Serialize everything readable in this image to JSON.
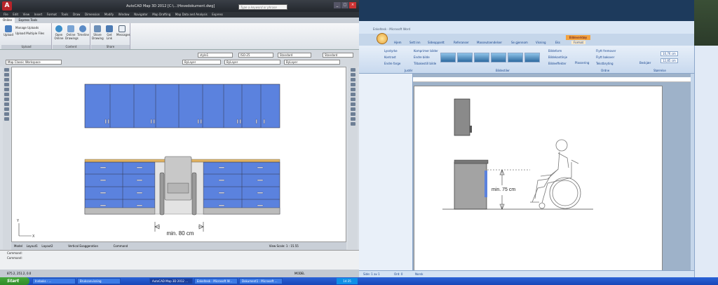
{
  "autocad": {
    "title": "AutoCAD Map 3D 2012  [C:\\...\\Hovedokument.dwg]",
    "search_placeholder": "Type a keyword or phrase",
    "menu": [
      "File",
      "Edit",
      "View",
      "Insert",
      "Format",
      "Tools",
      "Draw",
      "Dimension",
      "Modify",
      "Window",
      "Navigator",
      "Map Drafting",
      "Map Data and Analysis",
      "Express"
    ],
    "tabs": [
      "Online",
      "Express Tools"
    ],
    "ribbon": {
      "upload_group": {
        "label": "Upload",
        "upload": "Upload",
        "manage": "Manage Uploads",
        "multiple": "Upload Multiple Files"
      },
      "content_group": {
        "label": "Content",
        "open_online": "Open Online",
        "online_drawings": "Online Drawings",
        "timeline": "Timeline"
      },
      "share_group": {
        "label": "Share",
        "share_drawing": "Share Drawing",
        "get_link": "Get Link",
        "messages": "Messages"
      }
    },
    "props": {
      "style": "style1",
      "dimstyle": "ISO-25",
      "tablestyle": "Standard",
      "mleaderstyle": "Standard",
      "workspace": "Map Classic Workspace",
      "color": "ByLayer",
      "linetype": "ByLayer",
      "lineweight": "ByLayer"
    },
    "drawing": {
      "dimension_label": "min. 80 cm"
    },
    "layout_tabs": [
      "Model",
      "Layout1",
      "Layout2"
    ],
    "vertical_exaggeration": "Vertical Exaggeration",
    "command_label": "Command",
    "view_scale": "View Scale: 1 : 15.55",
    "command_lines": [
      "Command:",
      "Command:"
    ],
    "status": {
      "coords": "875.2, 251.2, 0.0",
      "model": "MODEL"
    }
  },
  "word": {
    "title": "Enkeltesk - Microsoft Word",
    "context_tab": "Bildeverktøy",
    "tabs": [
      "Hjem",
      "Sett inn",
      "Sideoppsett",
      "Referanser",
      "Masseutsendelser",
      "Se gjennom",
      "Visning",
      "Eks",
      "Format"
    ],
    "ribbon": {
      "justere_label": "Justér",
      "lysstyrke": "Lysstyrke",
      "kontrast": "Kontrast",
      "endre_farge": "Endre farge",
      "komprimer": "Komprimer bilder",
      "endre_bilde": "Endre bilde",
      "tilbakestill": "Tilbakestill bilde",
      "bildestiler_label": "Bildestiler",
      "bildeform": "Bildeform",
      "bildekantlinje": "Bildekantlinje",
      "bildeeffekter": "Bildeeffekter",
      "ordne_label": "Ordne",
      "plassering": "Plassering",
      "flytt_frem": "Flytt fremover",
      "flytt_bak": "Flytt bakover",
      "tekstbryting": "Tekstbryting",
      "storrelse_label": "Størrelse",
      "beskjaer": "Beskjær",
      "height": "10,76 cm",
      "width": "12,85 cm"
    },
    "drawing": {
      "dimension_label": "min. 75 cm"
    },
    "status": {
      "page": "Side: 1 av 1",
      "words": "Ord: 0",
      "lang": "Norsk"
    }
  },
  "taskbar": {
    "start": "Start",
    "tasks": [
      "Innboks - ...",
      "Bruksanvisning",
      "AutoCAD Map 3D 2012 ...",
      "Enkeltesk - Microsoft W...",
      "Dokument1 - Microsoft ..."
    ],
    "clock": "14:35"
  }
}
